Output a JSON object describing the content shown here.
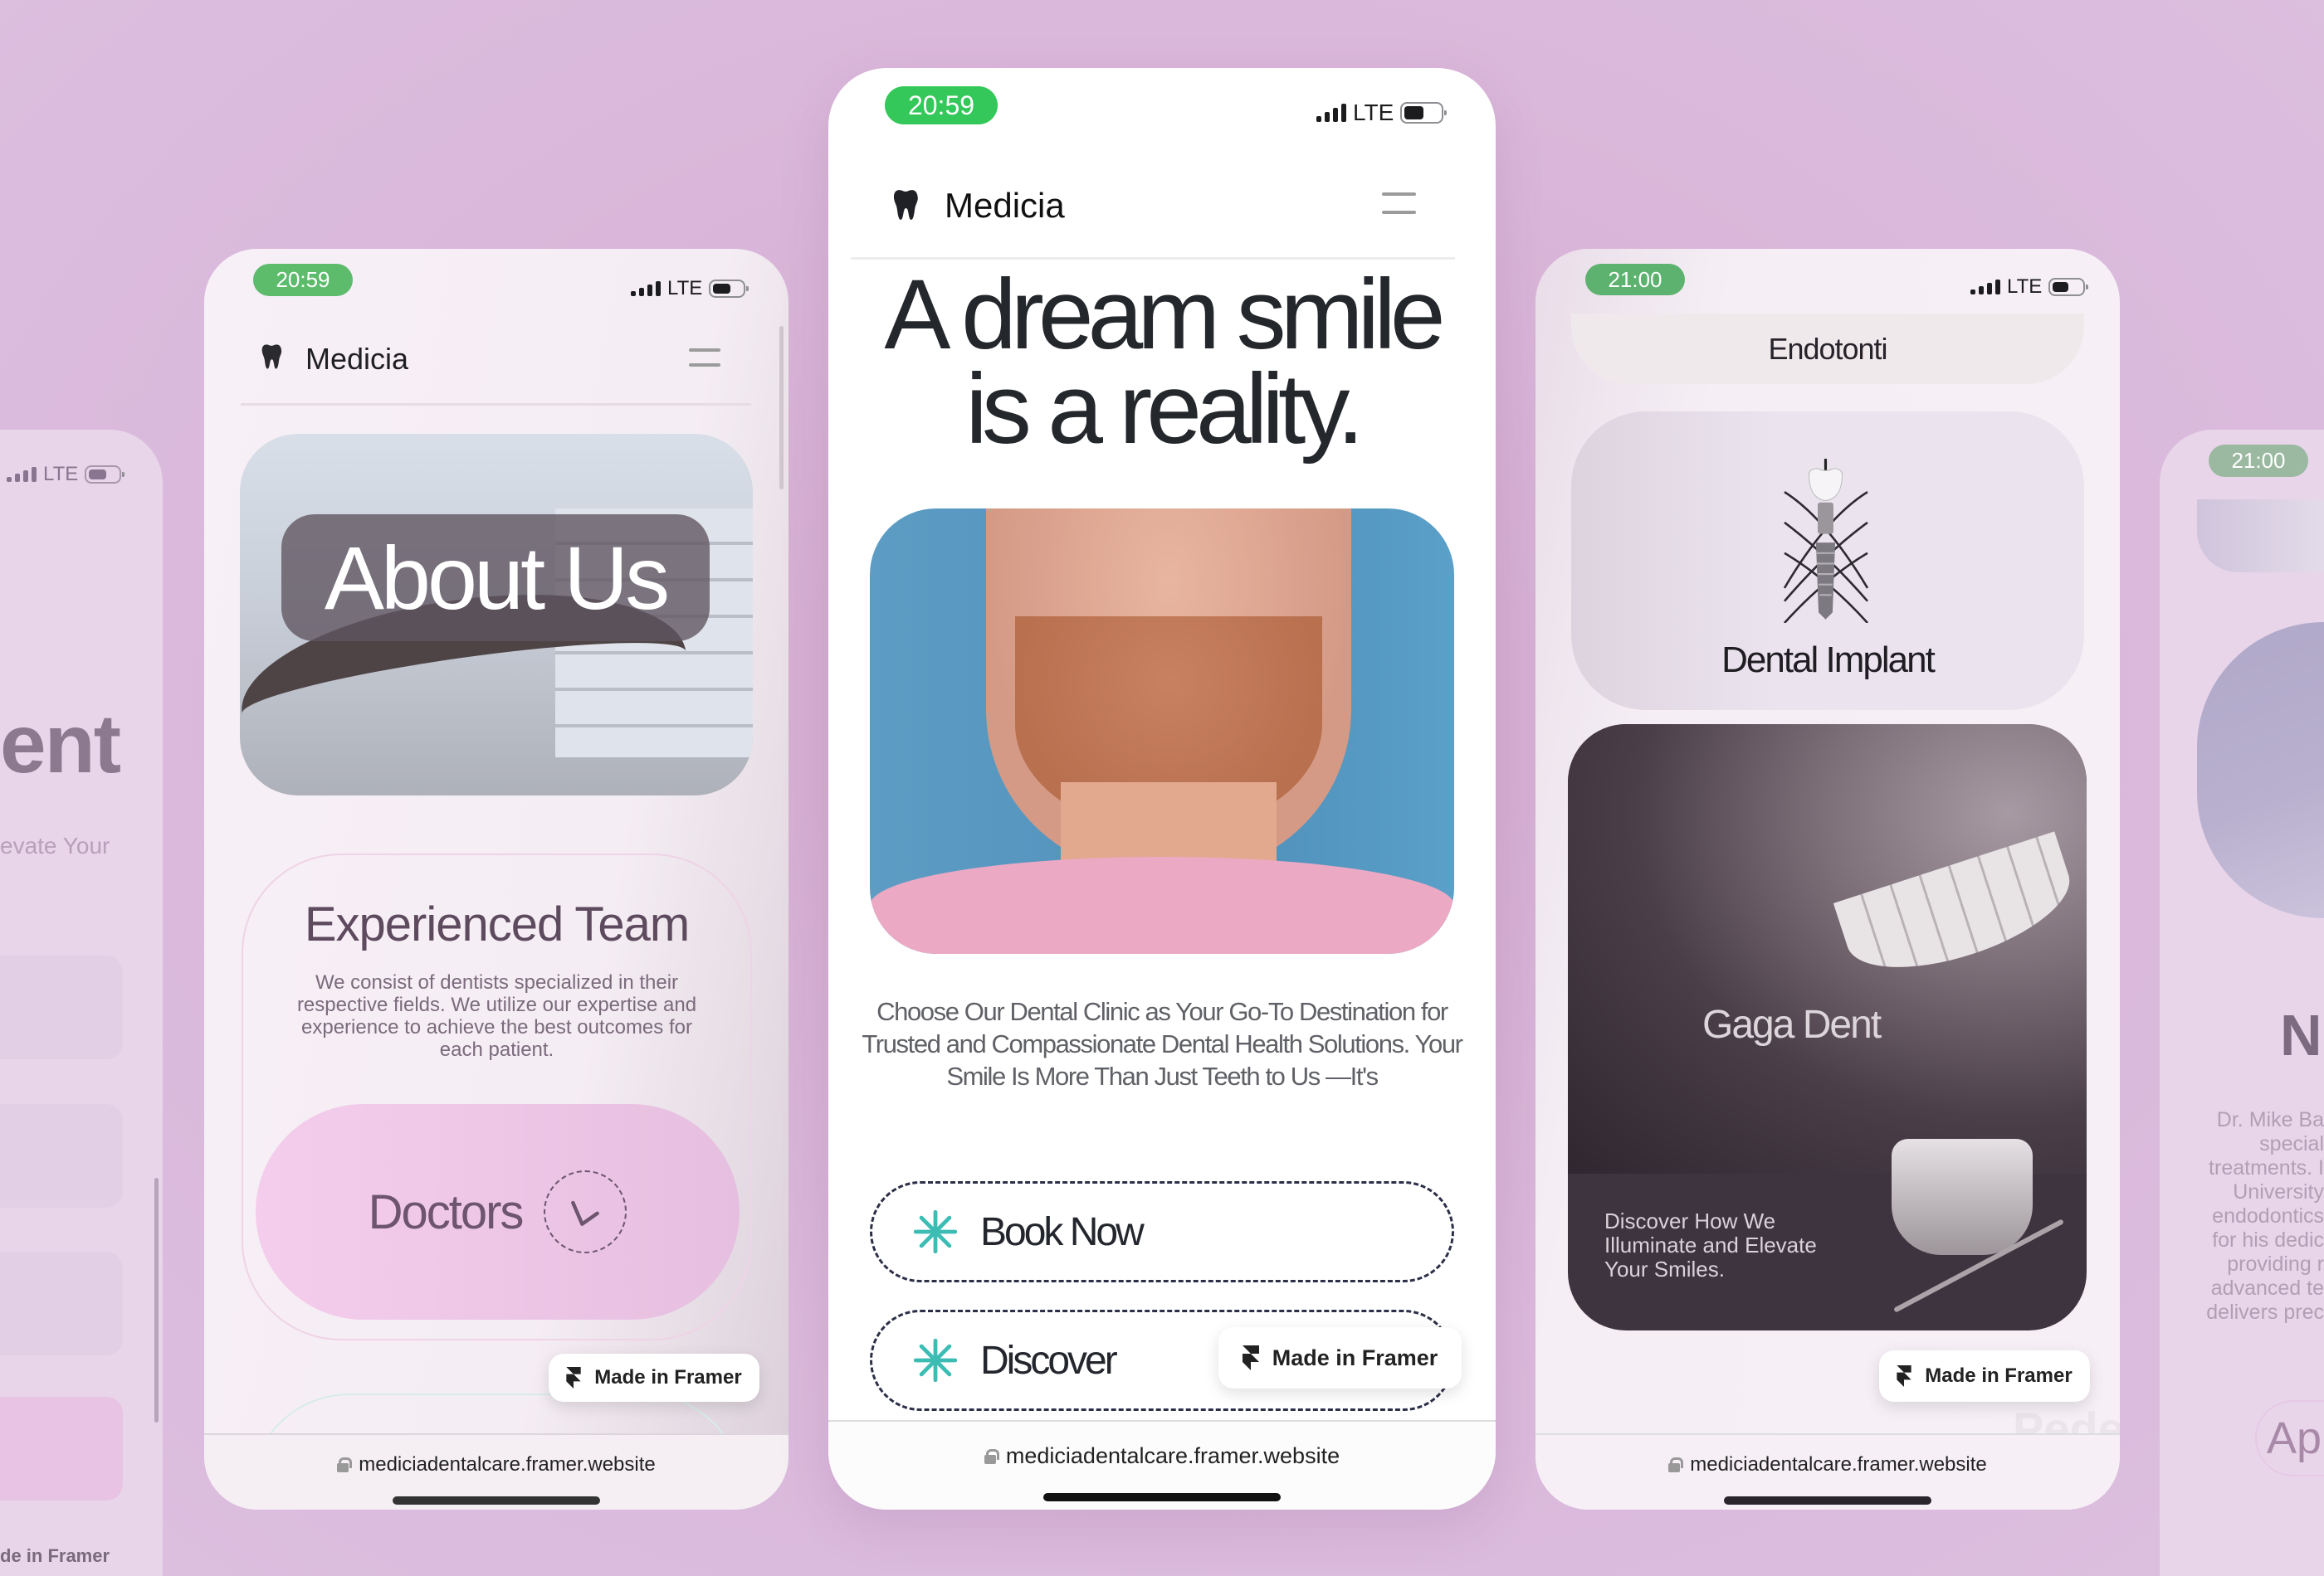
{
  "background_color": "#d9b7da",
  "phones": {
    "far_left": {
      "status": {
        "network": "LTE"
      },
      "heading_fragment": "ent",
      "subtitle_fragment": "evate Your",
      "framer_badge": "de in Framer"
    },
    "left": {
      "status": {
        "time": "20:59",
        "network": "LTE",
        "time_color": "#5dbb6c"
      },
      "nav": {
        "brand": "Medicia",
        "logo_icon": "tooth-icon",
        "menu_icon": "hamburger-icon"
      },
      "hero": {
        "overlay_title": "About Us"
      },
      "team_card": {
        "title": "Experienced Team",
        "body": "We consist of dentists specialized in their respective fields. We utilize our expertise and experience to achieve the best outcomes for each patient.",
        "button_label": "Doctors",
        "button_icon": "arrow-down-left-icon",
        "button_color": "#f4cdea"
      },
      "framer_badge": "Made in Framer",
      "url": "mediciadentalcare.framer.website"
    },
    "center": {
      "status": {
        "time": "20:59",
        "network": "LTE",
        "time_color": "#34c759"
      },
      "nav": {
        "brand": "Medicia",
        "logo_icon": "tooth-icon",
        "menu_icon": "hamburger-icon"
      },
      "headline": {
        "line1": "A dream smile",
        "line2": "is a reality."
      },
      "description": "Choose Our Dental Clinic as Your Go-To Destination for Trusted and Compassionate Dental Health Solutions. Your Smile Is More Than Just Teeth to Us —It's",
      "buttons": [
        {
          "label": "Book Now",
          "icon": "asterisk-icon"
        },
        {
          "label": "Discover",
          "icon": "asterisk-icon"
        }
      ],
      "accent_color": "#3bbdb4",
      "framer_badge": "Made in Framer",
      "url": "mediciadentalcare.framer.website"
    },
    "right": {
      "status": {
        "time": "21:00",
        "network": "LTE",
        "time_color": "#5cb26e"
      },
      "services": [
        {
          "title": "Endotonti"
        },
        {
          "title": "Dental Implant",
          "icon": "dental-implant-icon"
        }
      ],
      "feature_card": {
        "brand": "Gaga Dent",
        "tagline": "Discover How We Illuminate and Elevate Your Smiles."
      },
      "faded_text": "Pede",
      "framer_badge": "Made in Framer",
      "url": "mediciadentalcare.framer.website"
    },
    "far_right": {
      "status": {
        "time": "21:00",
        "time_color": "#9ab9a0"
      },
      "heading_fragment": "N",
      "bio_lines": [
        "Dr. Mike Ba",
        "special",
        "treatments. I",
        "University",
        "endodontics",
        "for his dedic",
        "providing r",
        "advanced te",
        "delivers prec"
      ],
      "button_fragment": "Ap"
    }
  }
}
